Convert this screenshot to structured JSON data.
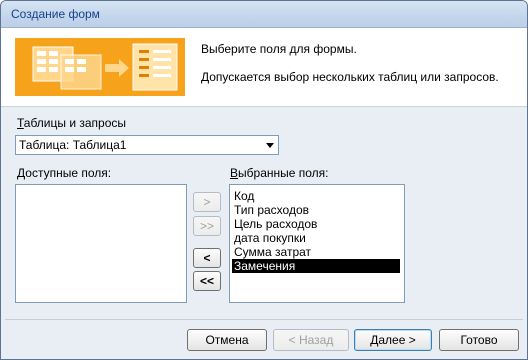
{
  "window": {
    "title": "Создание форм"
  },
  "header": {
    "line1": "Выберите поля для формы.",
    "line2": "Допускается выбор нескольких таблиц или запросов."
  },
  "tables": {
    "label_accel": "Т",
    "label_rest": "аблицы и запросы",
    "selected": "Таблица: Таблица1"
  },
  "available": {
    "label_accel": "Д",
    "label_rest": "оступные поля:",
    "items": []
  },
  "chosen": {
    "label_accel": "В",
    "label_rest": "ыбранные поля:",
    "items": [
      "Код",
      "Тип расходов",
      "Цель расходов",
      "дата покупки",
      "Сумма затрат",
      "Замечения"
    ],
    "selected_index": 5
  },
  "move_buttons": {
    "add": ">",
    "add_all": ">>",
    "remove": "<",
    "remove_all": "<<"
  },
  "footer": {
    "cancel": "Отмена",
    "back": "< Назад",
    "next": "Далее >",
    "finish": "Готово"
  },
  "colors": {
    "banner": "#f6a21a",
    "title_text": "#15428b",
    "selection": "#000000"
  }
}
